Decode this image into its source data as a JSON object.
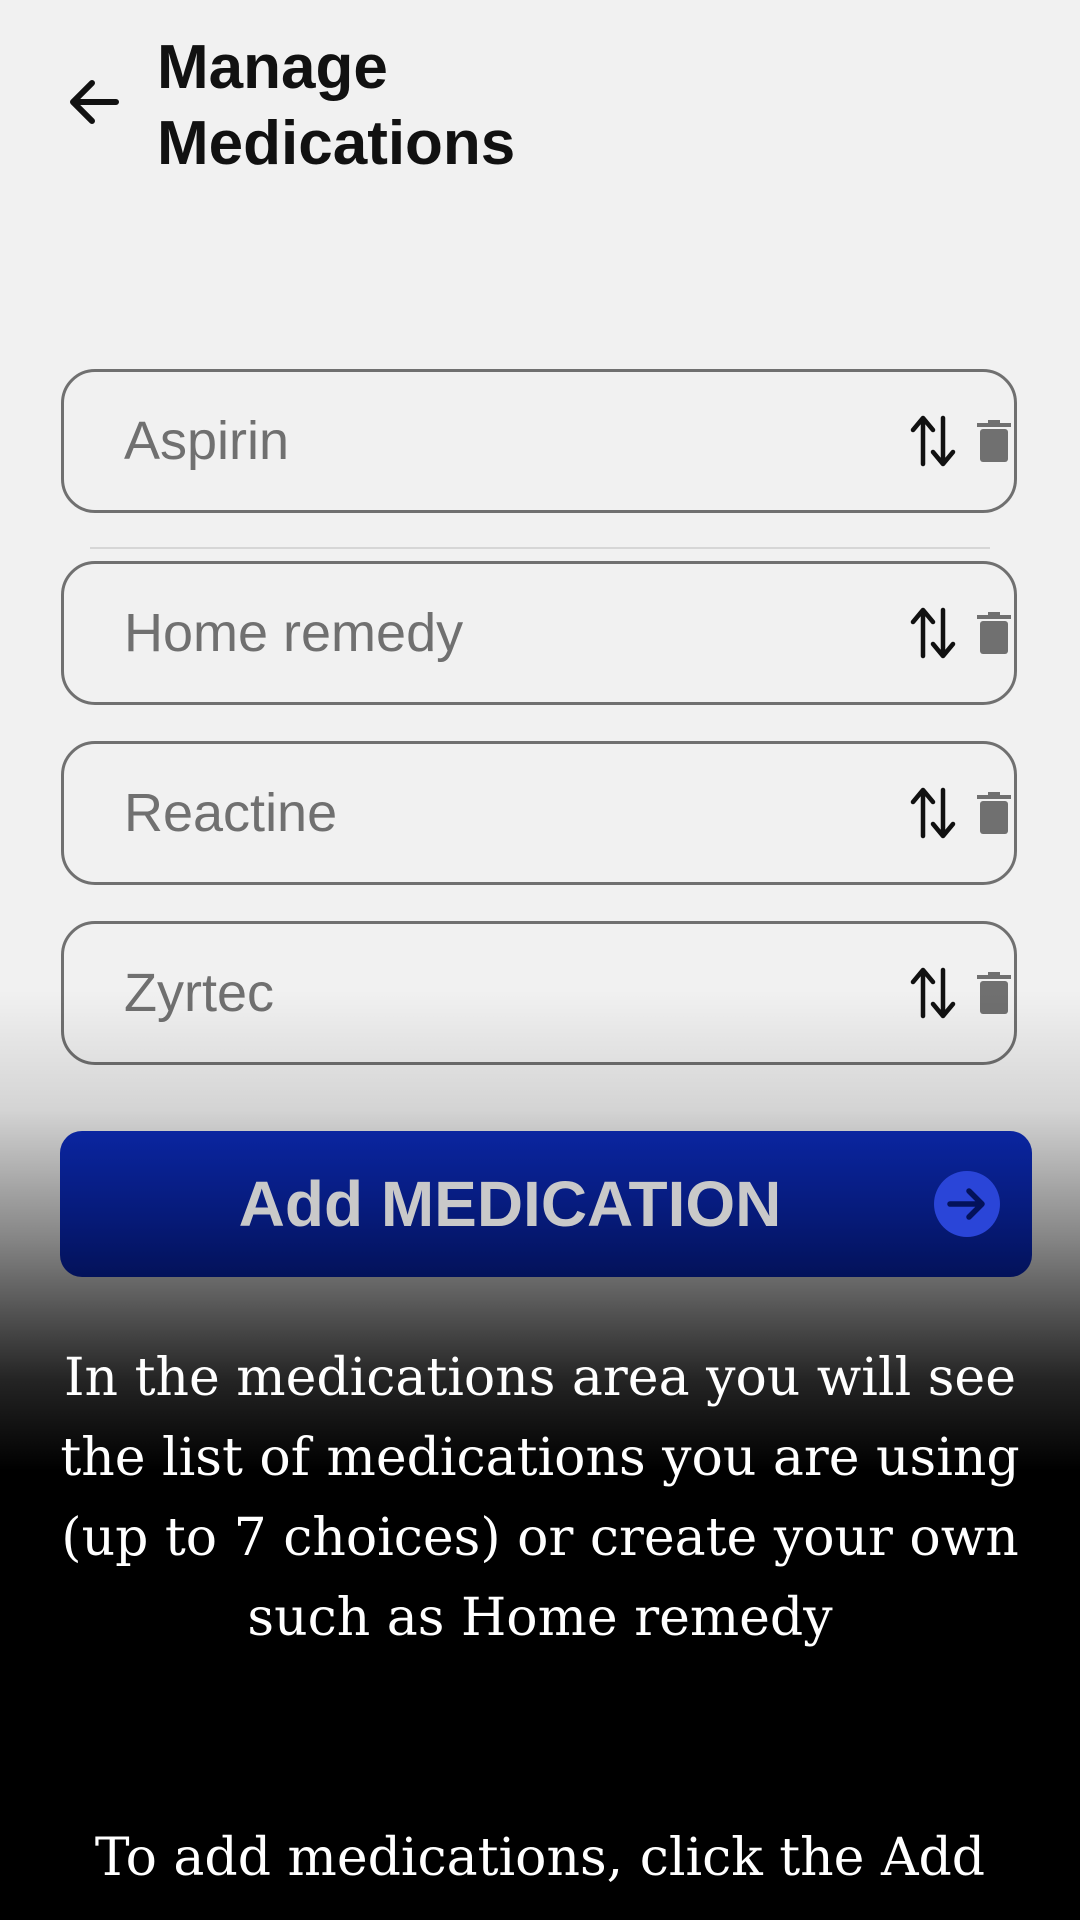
{
  "header": {
    "back_icon": "arrow-left-icon",
    "title_line1": "Manage",
    "title_line2": "Medications"
  },
  "medications": [
    {
      "name": "Aspirin"
    },
    {
      "name": "Home remedy"
    },
    {
      "name": "Reactine"
    },
    {
      "name": "Zyrtec"
    }
  ],
  "row_icons": {
    "sort": "sort-updown-icon",
    "delete": "trash-icon"
  },
  "add_button": {
    "label": "Add MEDICATION",
    "icon": "arrow-right-circle-icon",
    "color": "#0a25a0"
  },
  "tips": [
    "In the medications area you will see the list of medications you are using (up to 7 choices) or create your own such as Home remedy",
    "To add medications, click the Add"
  ]
}
